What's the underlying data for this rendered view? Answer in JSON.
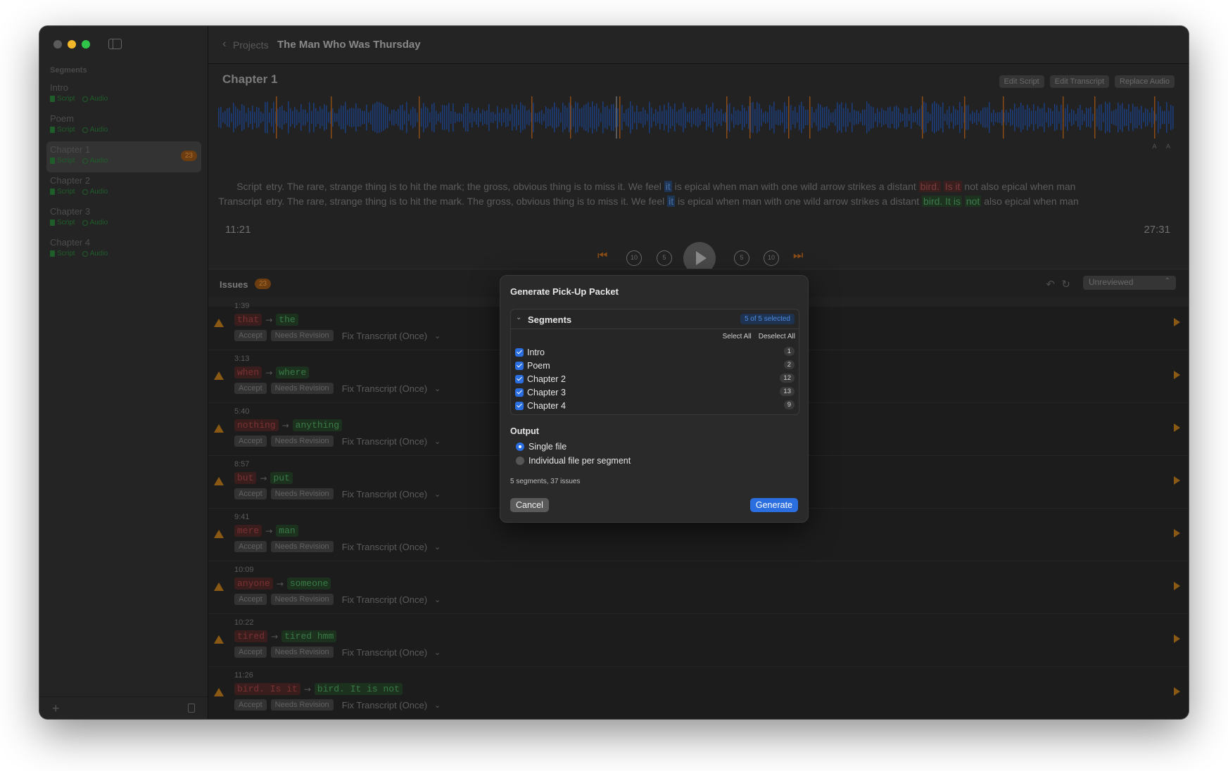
{
  "sidebar": {
    "header": "Segments",
    "items": [
      {
        "name": "Intro",
        "script": "Script",
        "audio": "Audio",
        "badge": ""
      },
      {
        "name": "Poem",
        "script": "Script",
        "audio": "Audio",
        "badge": ""
      },
      {
        "name": "Chapter 1",
        "script": "Script",
        "audio": "Audio",
        "badge": "23"
      },
      {
        "name": "Chapter 2",
        "script": "Script",
        "audio": "Audio",
        "badge": ""
      },
      {
        "name": "Chapter 3",
        "script": "Script",
        "audio": "Audio",
        "badge": ""
      },
      {
        "name": "Chapter 4",
        "script": "Script",
        "audio": "Audio",
        "badge": ""
      }
    ],
    "add_label": "+"
  },
  "titlebar": {
    "back_label": "Projects",
    "title": "The Man Who Was Thursday"
  },
  "chapter": {
    "title": "Chapter 1",
    "buttons": [
      "Edit Script",
      "Edit Transcript",
      "Replace Audio"
    ],
    "scale_label": "A A",
    "script_label": "Script",
    "transcript_label": "Transcript",
    "script_text": {
      "pre": "etry. The rare, strange thing is to hit the mark;  the  gross, obvious thing is to miss it. We feel ",
      "hl": "it",
      "mid": " is epical when man with one wild arrow strikes a distant ",
      "red1": "bird.",
      "red2": "Is it",
      "post": " not also epical when man"
    },
    "transcript_text": {
      "pre": "etry. The rare, strange thing is to hit the mark. The gross, obvious thing is to miss it. We feel ",
      "hl": "it",
      "mid": " is epical when man with one wild arrow strikes a distant ",
      "green1": "bird. It is",
      "green2": "not",
      "post": " also epical when man"
    },
    "time_current": "11:21",
    "time_total": "27:31",
    "transport": {
      "back10": "10",
      "back5": "5",
      "fwd5": "5",
      "fwd10": "10"
    }
  },
  "issues": {
    "title": "Issues",
    "count": "23",
    "filter": "Unreviewed",
    "accept_label": "Accept",
    "revision_label": "Needs Revision",
    "fix_label": "Fix Transcript (Once)",
    "items": [
      {
        "time": "1:39",
        "old": "that",
        "new": "the"
      },
      {
        "time": "3:13",
        "old": "when",
        "new": "where"
      },
      {
        "time": "5:40",
        "old": "nothing",
        "new": "anything"
      },
      {
        "time": "8:57",
        "old": "but",
        "new": "put"
      },
      {
        "time": "9:41",
        "old": "mere",
        "new": "man"
      },
      {
        "time": "10:09",
        "old": "anyone",
        "new": "someone"
      },
      {
        "time": "10:22",
        "old": "tired",
        "new": "tired hmm"
      },
      {
        "time": "11:26",
        "old": "bird. Is it",
        "new": "bird. It is not"
      }
    ]
  },
  "modal": {
    "title": "Generate Pick-Up Packet",
    "segments_title": "Segments",
    "selected_badge": "5 of 5 selected",
    "select_all": "Select All",
    "deselect_all": "Deselect All",
    "segments": [
      {
        "name": "Intro",
        "count": "1"
      },
      {
        "name": "Poem",
        "count": "2"
      },
      {
        "name": "Chapter 2",
        "count": "12"
      },
      {
        "name": "Chapter 3",
        "count": "13"
      },
      {
        "name": "Chapter 4",
        "count": "9"
      }
    ],
    "output_title": "Output",
    "option_single": "Single file",
    "option_individual": "Individual file per segment",
    "summary": "5 segments, 37 issues",
    "cancel": "Cancel",
    "generate": "Generate"
  },
  "colors": {
    "accent": "#2a6ee0",
    "warning": "#8a5a14",
    "waveform": "#1c3d7a",
    "marker": "#8a4c14"
  }
}
